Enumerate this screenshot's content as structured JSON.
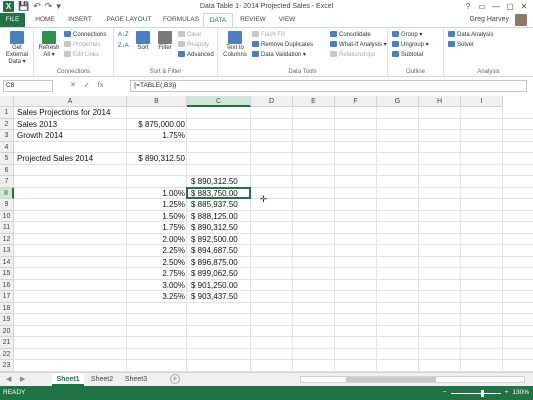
{
  "window": {
    "title": "Data Table 1- 2014 Projected Sales - Excel",
    "user": "Greg Harvey",
    "controls": [
      "?",
      "▭",
      "—",
      "▢",
      "✕"
    ]
  },
  "quick_access": [
    "💾",
    "↶",
    "↷",
    "▾"
  ],
  "tabs": [
    "FILE",
    "HOME",
    "INSERT",
    "PAGE LAYOUT",
    "FORMULAS",
    "DATA",
    "REVIEW",
    "VIEW"
  ],
  "ribbon": {
    "get_external": "Get External Data ▾",
    "refresh": "Refresh All ▾",
    "connections": "Connections",
    "properties": "Properties",
    "edit_links": "Edit Links",
    "sort_az": "A↓Z",
    "sort_za": "Z↓A",
    "sort": "Sort",
    "filter": "Filter",
    "clear": "Clear",
    "reapply": "Reapply",
    "advanced": "Advanced",
    "text_to_columns": "Text to Columns",
    "flash_fill": "Flash Fill",
    "remove_duplicates": "Remove Duplicates",
    "data_validation": "Data Validation ▾",
    "consolidate": "Consolidate",
    "what_if": "What-If Analysis ▾",
    "relationships": "Relationships",
    "group": "Group ▾",
    "ungroup": "Ungroup ▾",
    "subtotal": "Subtotal",
    "data_analysis": "Data Analysis",
    "solver": "Solver",
    "groups": [
      "Connections",
      "Sort & Filter",
      "Data Tools",
      "Outline",
      "Analysis"
    ]
  },
  "formula_bar": {
    "name_box": "C8",
    "icons": [
      "✕",
      "✓",
      "fx"
    ],
    "formula": "{=TABLE(,B3)}"
  },
  "columns": [
    "A",
    "B",
    "C",
    "D",
    "E",
    "F",
    "G",
    "H",
    "I"
  ],
  "rows": [
    "1",
    "2",
    "3",
    "4",
    "5",
    "6",
    "7",
    "8",
    "9",
    "10",
    "11",
    "12",
    "13",
    "14",
    "15",
    "16",
    "17",
    "18",
    "19",
    "20",
    "21",
    "22",
    "23"
  ],
  "cells": {
    "A1": "Sales Projections for 2014",
    "A2": "Sales 2013",
    "B2": "$ 875,000.00",
    "A3": "Growth 2014",
    "B3": "1.75%",
    "A5": "Projected Sales 2014",
    "B5": "$ 890,312.50",
    "C7": "$ 890,312.50",
    "B8": "1.00%",
    "C8": "$ 883,750.00",
    "B9": "1.25%",
    "C9": "$ 885,937.50",
    "B10": "1.50%",
    "C10": "$ 888,125.00",
    "B11": "1.75%",
    "C11": "$ 890,312.50",
    "B12": "2.00%",
    "C12": "$ 892,500.00",
    "B13": "2.25%",
    "C13": "$ 894,687.50",
    "B14": "2.50%",
    "C14": "$ 896,875.00",
    "B15": "2.75%",
    "C15": "$ 899,062.50",
    "B16": "3.00%",
    "C16": "$ 901,250.00",
    "B17": "3.25%",
    "C17": "$ 903,437.50"
  },
  "sheets": [
    "Sheet1",
    "Sheet2",
    "Sheet3"
  ],
  "status": {
    "ready": "READY",
    "zoom": "130%"
  },
  "colors": {
    "excel_green": "#217346"
  }
}
